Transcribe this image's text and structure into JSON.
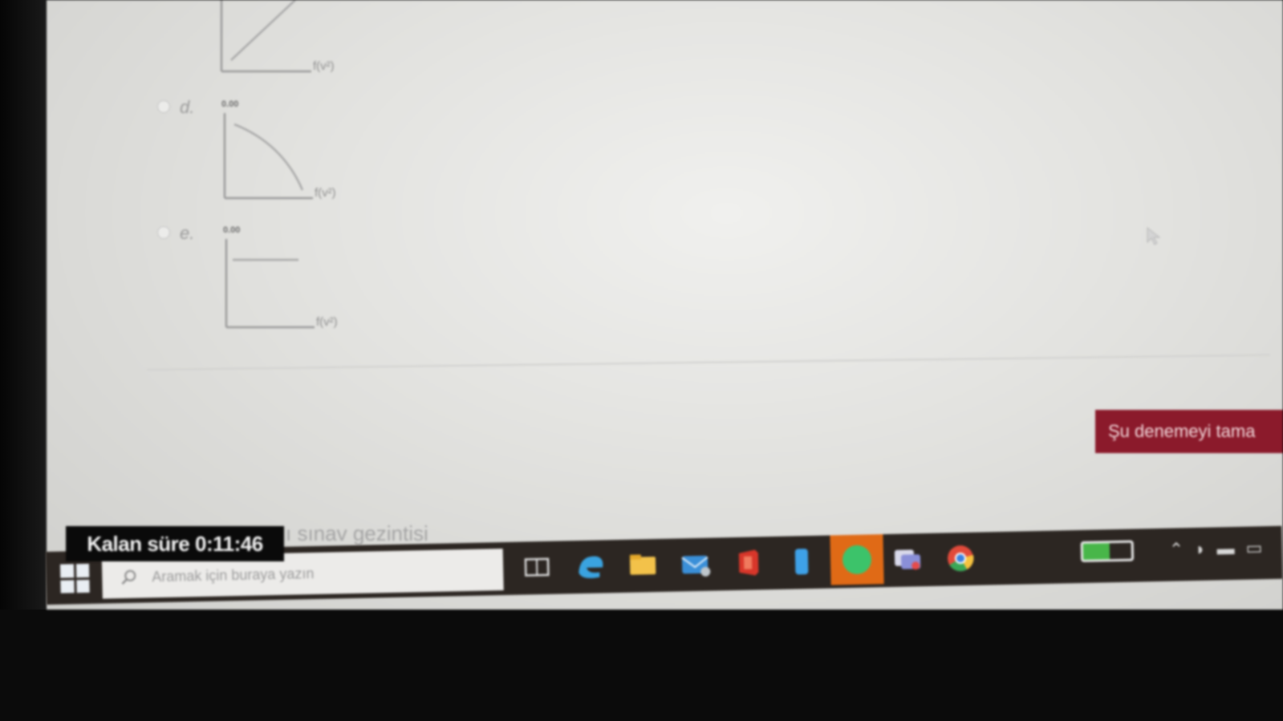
{
  "options": [
    {
      "letter": "",
      "curve": "linear-rise"
    },
    {
      "letter": "d.",
      "axis_label": "0.00",
      "x_label": "f(v²)",
      "curve": "concave-decline"
    },
    {
      "letter": "e.",
      "axis_label": "0.00",
      "x_label": "f(v²)",
      "curve": "flat"
    }
  ],
  "top_chart": {
    "x_label": "f(v²)"
  },
  "finish_button": {
    "label": "Şu denemeyi tama"
  },
  "nav": {
    "label": "ı sınav gezintisi"
  },
  "timer": {
    "label": "Kalan süre 0:11:46"
  },
  "taskbar": {
    "search_placeholder": "Aramak için buraya yazın",
    "apps": [
      "task-view-icon",
      "edge-icon",
      "file-explorer-icon",
      "mail-icon",
      "office-icon",
      "phone-icon",
      "spotify-icon",
      "teams-icon",
      "chrome-icon"
    ],
    "tray": [
      "battery-icon",
      "chevron-up-icon",
      "wifi-icon",
      "speaker-icon",
      "keyboard-icon"
    ]
  },
  "colors": {
    "finish_button": "#8b1a2b",
    "taskbar": "#2c2622",
    "spotify": "#e06a16",
    "battery": "#48b649"
  }
}
